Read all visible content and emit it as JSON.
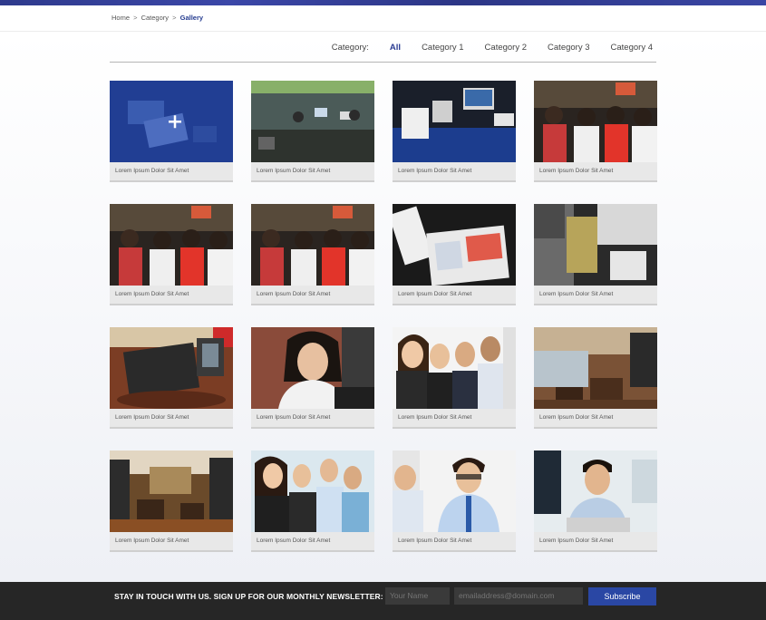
{
  "breadcrumb": {
    "home": "Home",
    "sep1": ">",
    "category": "Category",
    "sep2": ">",
    "current": "Gallery"
  },
  "filter": {
    "label": "Category:",
    "items": [
      "All",
      "Category 1",
      "Category 2",
      "Category 3",
      "Category 4"
    ],
    "active": "All"
  },
  "gallery": {
    "items": [
      {
        "caption": "Lorem Ipsum Dolor Sit Amet",
        "image": "add-overlay"
      },
      {
        "caption": "Lorem Ipsum Dolor Sit Amet",
        "image": "restaurant-counter"
      },
      {
        "caption": "Lorem Ipsum Dolor Sit Amet",
        "image": "pos-display-stand"
      },
      {
        "caption": "Lorem Ipsum Dolor Sit Amet",
        "image": "staff-group"
      },
      {
        "caption": "Lorem Ipsum Dolor Sit Amet",
        "image": "staff-group"
      },
      {
        "caption": "Lorem Ipsum Dolor Sit Amet",
        "image": "staff-group"
      },
      {
        "caption": "Lorem Ipsum Dolor Sit Amet",
        "image": "pos-keypad"
      },
      {
        "caption": "Lorem Ipsum Dolor Sit Amet",
        "image": "pos-collage"
      },
      {
        "caption": "Lorem Ipsum Dolor Sit Amet",
        "image": "pos-terminal"
      },
      {
        "caption": "Lorem Ipsum Dolor Sit Amet",
        "image": "businesswoman"
      },
      {
        "caption": "Lorem Ipsum Dolor Sit Amet",
        "image": "business-team"
      },
      {
        "caption": "Lorem Ipsum Dolor Sit Amet",
        "image": "cafe-interior"
      },
      {
        "caption": "Lorem Ipsum Dolor Sit Amet",
        "image": "store-interior"
      },
      {
        "caption": "Lorem Ipsum Dolor Sit Amet",
        "image": "team-celebrating"
      },
      {
        "caption": "Lorem Ipsum Dolor Sit Amet",
        "image": "office-meeting"
      },
      {
        "caption": "Lorem Ipsum Dolor Sit Amet",
        "image": "office-worker"
      }
    ]
  },
  "footer": {
    "newsletter_text": "STAY IN TOUCH WITH US. SIGN UP FOR OUR MONTHLY NEWSLETTER:",
    "name_placeholder": "Your Name",
    "email_placeholder": "emailaddress@domain.com",
    "subscribe_label": "Subscribe"
  },
  "colors": {
    "accent": "#2a3c93",
    "subscribe": "#2a47a4",
    "footer_bg": "#262626"
  }
}
